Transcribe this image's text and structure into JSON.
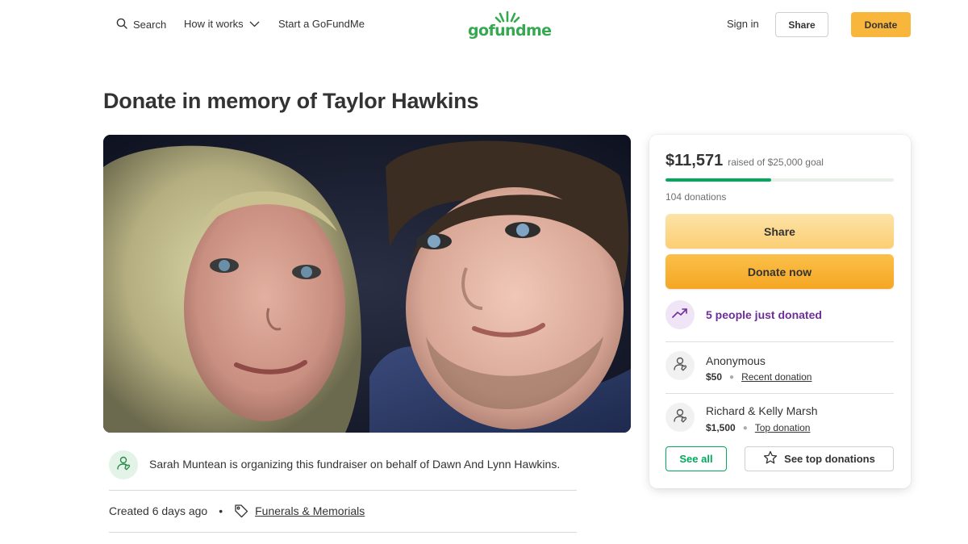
{
  "header": {
    "search_label": "Search",
    "how_it_works_label": "How it works",
    "start_label": "Start a GoFundMe",
    "logo_text": "gofundme",
    "sign_in_label": "Sign in",
    "share_label": "Share",
    "donate_label": "Donate"
  },
  "page": {
    "title": "Donate in memory of Taylor Hawkins"
  },
  "organizer": {
    "text": "Sarah Muntean is organizing this fundraiser on behalf of Dawn And Lynn Hawkins."
  },
  "meta": {
    "created": "Created 6 days ago",
    "category": "Funerals & Memorials"
  },
  "campaign": {
    "raised": "$11,571",
    "goal_text": "raised of $25,000 goal",
    "progress_fraction": 0.4628,
    "donations_count": "104 donations",
    "share_label": "Share",
    "donate_label": "Donate now",
    "recent_activity": "5 people just donated",
    "donors": [
      {
        "name": "Anonymous",
        "amount": "$50",
        "kind": "Recent donation"
      },
      {
        "name": "Richard & Kelly Marsh",
        "amount": "$1,500",
        "kind": "Top donation"
      }
    ],
    "see_all_label": "See all",
    "see_top_label": "See top donations"
  },
  "colors": {
    "brand_green": "#02a95c",
    "donate_yellow": "#f8b73c",
    "purple": "#6e2e9a"
  },
  "icons": [
    "search-icon",
    "chevron-down-icon",
    "logo-sun-icon",
    "heart-hand-icon",
    "tag-icon",
    "trending-up-icon",
    "star-icon"
  ]
}
